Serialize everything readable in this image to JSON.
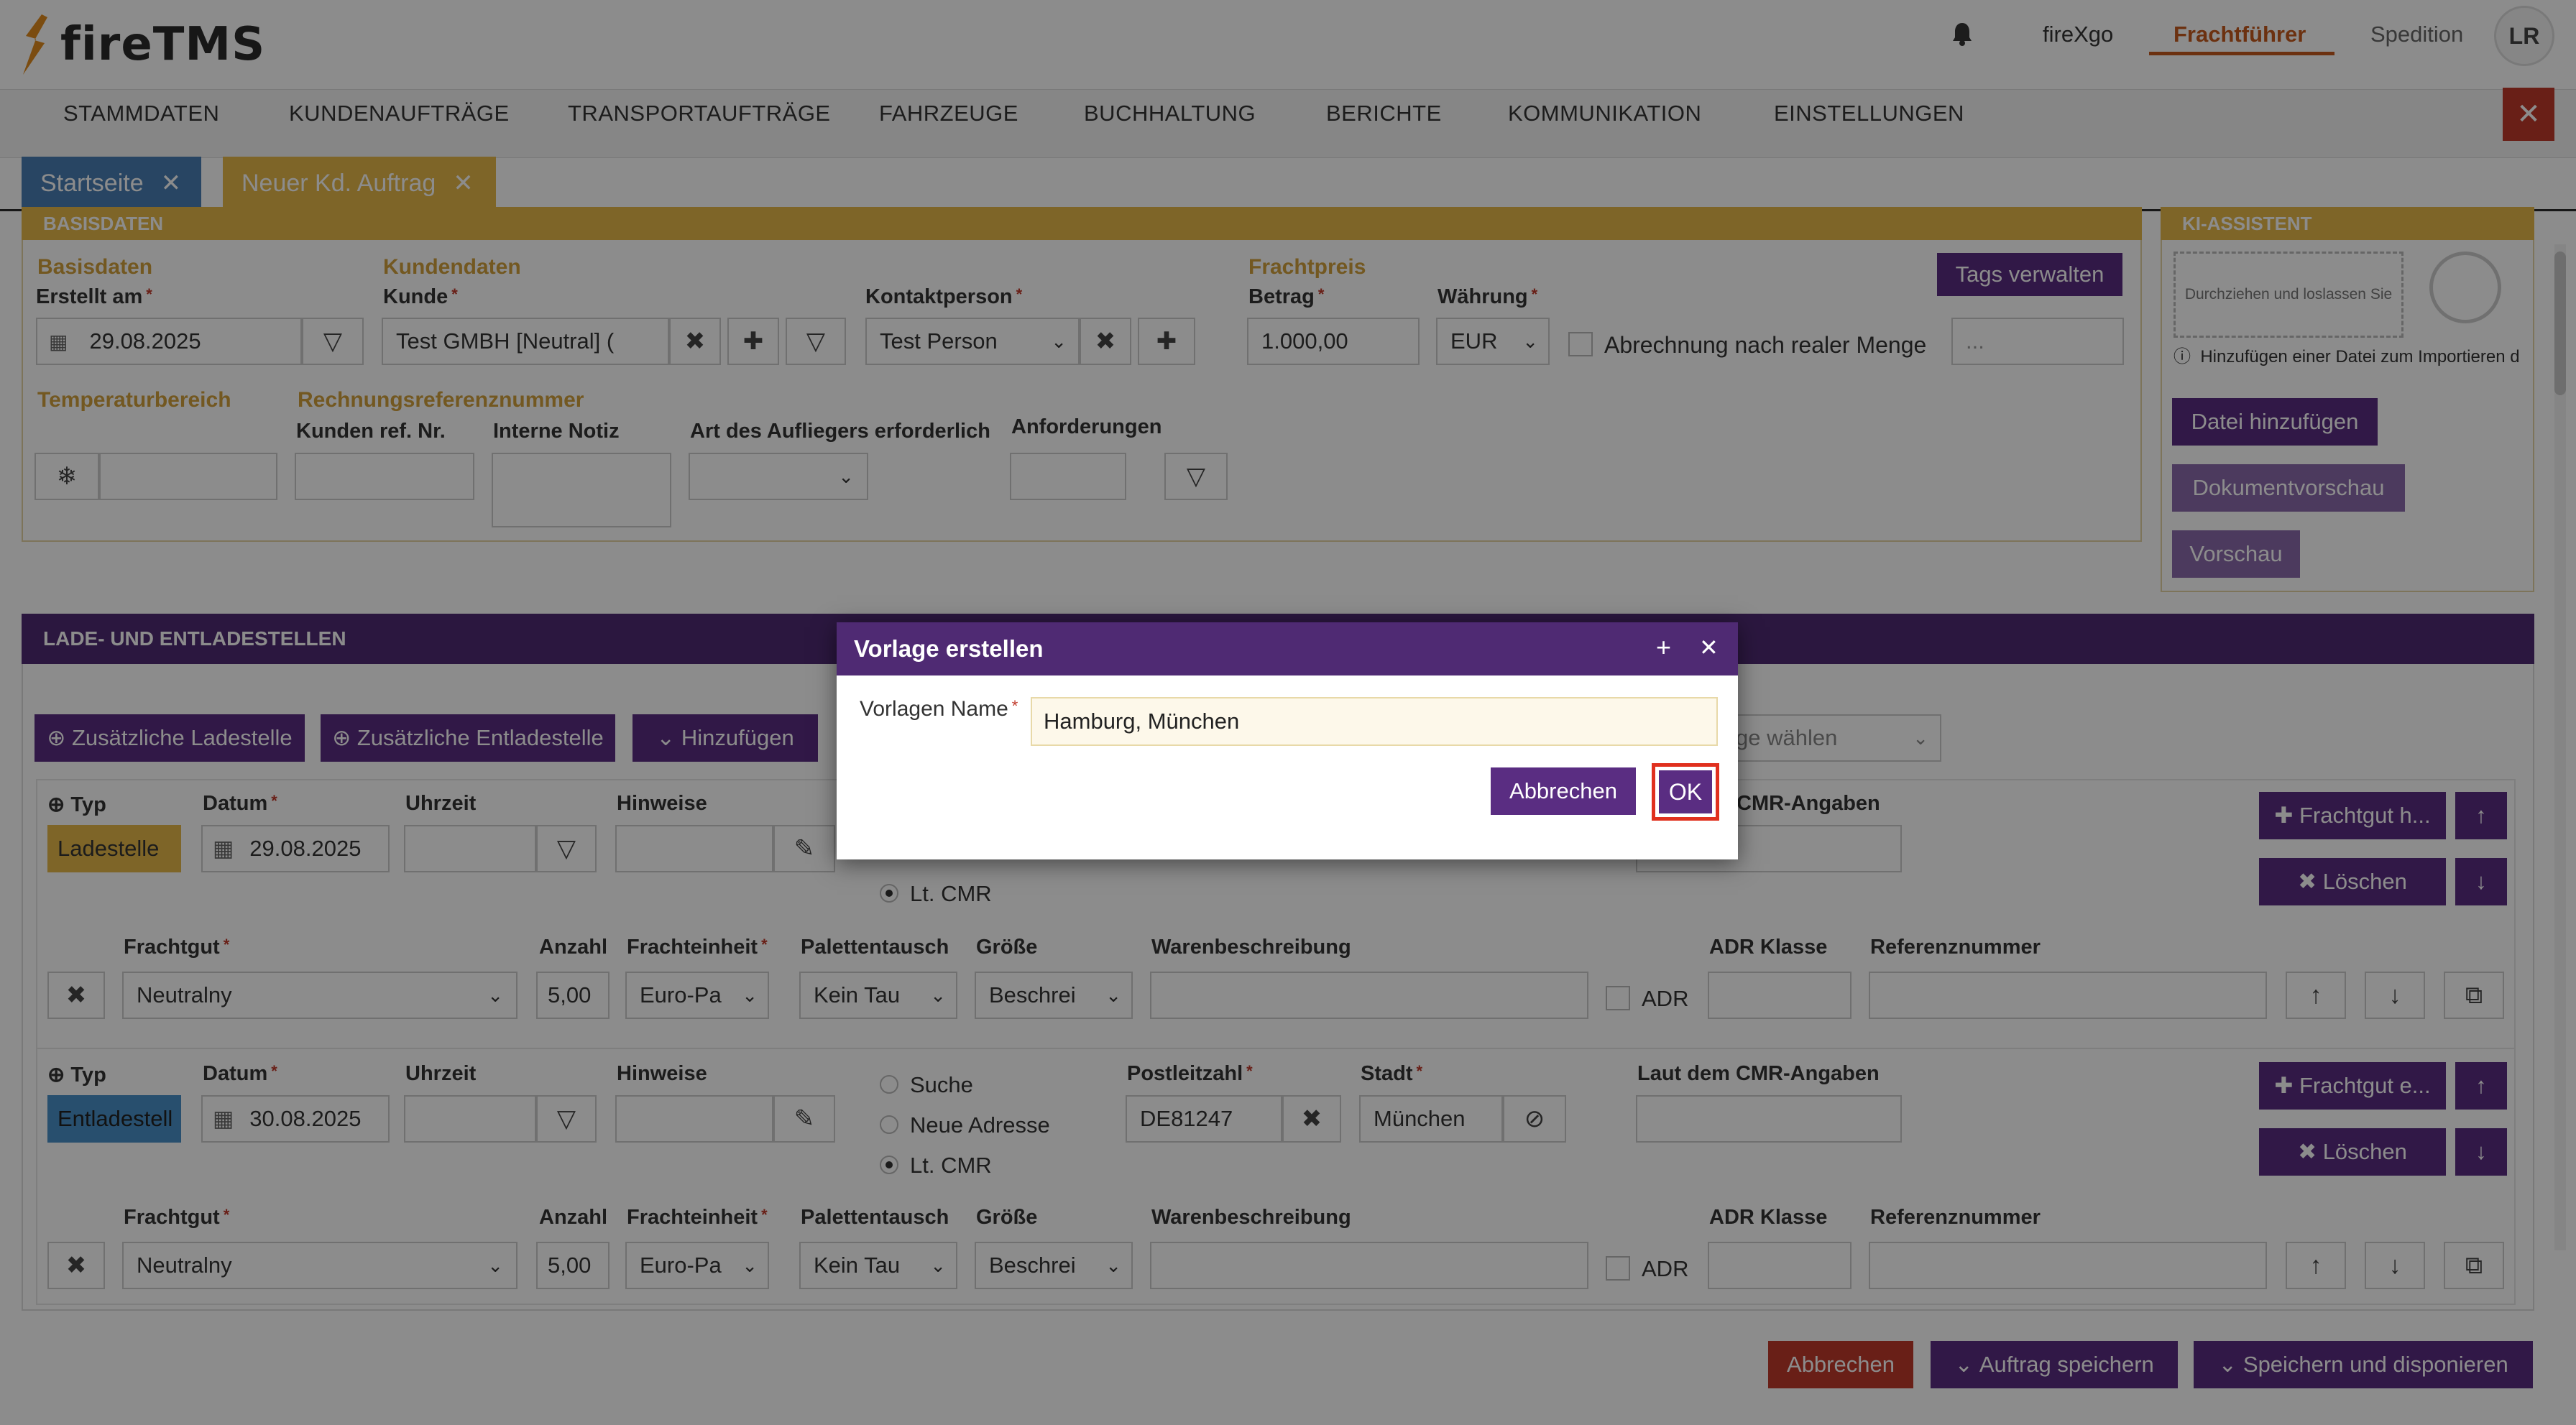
{
  "app": {
    "logo_text": "fireTMS",
    "user_initials": "LR"
  },
  "topnav": {
    "company": "fireXgo",
    "role_active": "Frachtführer",
    "role_other": "Spedition"
  },
  "menu": [
    "STAMMDATEN",
    "KUNDENAUFTRÄGE",
    "TRANSPORTAUFTRÄGE",
    "FAHRZEUGE",
    "BUCHHALTUNG",
    "BERICHTE",
    "KOMMUNIKATION",
    "EINSTELLUNGEN"
  ],
  "tabs": [
    {
      "label": "Startseite"
    },
    {
      "label": "Neuer Kd. Auftrag"
    }
  ],
  "basis": {
    "panel_title": "BASISDATEN",
    "sec_basisdaten": "Basisdaten",
    "erstellt_label": "Erstellt am",
    "erstellt_value": "29.08.2025",
    "sec_kundendaten": "Kundendaten",
    "kunde_label": "Kunde",
    "kunde_value": "Test GMBH [Neutral] (",
    "kontakt_label": "Kontaktperson",
    "kontakt_value": "Test Person",
    "sec_frachtpreis": "Frachtpreis",
    "betrag_label": "Betrag",
    "betrag_value": "1.000,00",
    "waehrung_label": "Währung",
    "waehrung_value": "EUR",
    "abrechnung_label": "Abrechnung nach realer Menge",
    "tags_button": "Tags verwalten",
    "tags_value": "...",
    "sec_temperatur": "Temperaturbereich",
    "sec_rechnung": "Rechnungsreferenznummer",
    "kunden_ref_label": "Kunden ref. Nr.",
    "interne_notiz_label": "Interne Notiz",
    "aufleger_label": "Art des Aufliegers erforderlich",
    "anforderungen_label": "Anforderungen"
  },
  "ki": {
    "panel_title": "KI-ASSISTENT",
    "drop_text": "Durchziehen und loslassen Sie",
    "hint": "Hinzufügen einer Datei zum Importieren d",
    "btn_add": "Datei hinzufügen",
    "btn_preview_doc": "Dokumentvorschau",
    "btn_preview": "Vorschau"
  },
  "stops": {
    "panel_title": "LADE- UND ENTLADESTELLEN",
    "btn_lade": "Zusätzliche Ladestelle",
    "btn_entlade": "Zusätzliche Entladestelle",
    "btn_hinzu": "Hinzufügen",
    "vorlage_select": "ge wählen",
    "col_typ": "Typ",
    "col_datum": "Datum",
    "col_uhrzeit": "Uhrzeit",
    "col_hinweise": "Hinweise",
    "col_plz": "Postleitzahl",
    "col_stadt": "Stadt",
    "col_cmr": "Laut dem CMR-Angaben",
    "col_cmr_short": "CMR-Angaben",
    "opt_suche": "Suche",
    "opt_neue": "Neue Adresse",
    "opt_cmr": "Lt. CMR",
    "col_frachtgut": "Frachtgut",
    "col_anzahl": "Anzahl",
    "col_frachteinheit": "Frachteinheit",
    "col_palette": "Palettentausch",
    "col_groesse": "Größe",
    "col_waren": "Warenbeschreibung",
    "col_adr": "ADR Klasse",
    "col_ref": "Referenznummer",
    "adr_label": "ADR",
    "btn_fracht_1": "Frachtgut h...",
    "btn_fracht_2": "Frachtgut e...",
    "btn_loeschen": "Löschen",
    "stop1": {
      "typ": "Ladestelle",
      "datum": "29.08.2025",
      "frachtgut": "Neutralny",
      "anzahl": "5,00",
      "einheit": "Euro-Pa",
      "palette": "Kein Tau",
      "groesse": "Beschrei"
    },
    "stop2": {
      "typ": "Entladestell",
      "datum": "30.08.2025",
      "plz": "DE81247",
      "stadt": "München",
      "frachtgut": "Neutralny",
      "anzahl": "5,00",
      "einheit": "Euro-Pa",
      "palette": "Kein Tau",
      "groesse": "Beschrei"
    }
  },
  "footer": {
    "btn_abbrechen": "Abbrechen",
    "btn_speichern": "Auftrag speichern",
    "btn_disponieren": "Speichern und disponieren"
  },
  "modal": {
    "title": "Vorlage erstellen",
    "name_label": "Vorlagen Name",
    "name_value": "Hamburg, München",
    "btn_cancel": "Abbrechen",
    "btn_ok": "OK"
  },
  "colors": {
    "brand_purple": "#5a2d82",
    "accent_orange": "#c55a1e",
    "gold": "#d1a13c",
    "danger": "#c0392b"
  }
}
